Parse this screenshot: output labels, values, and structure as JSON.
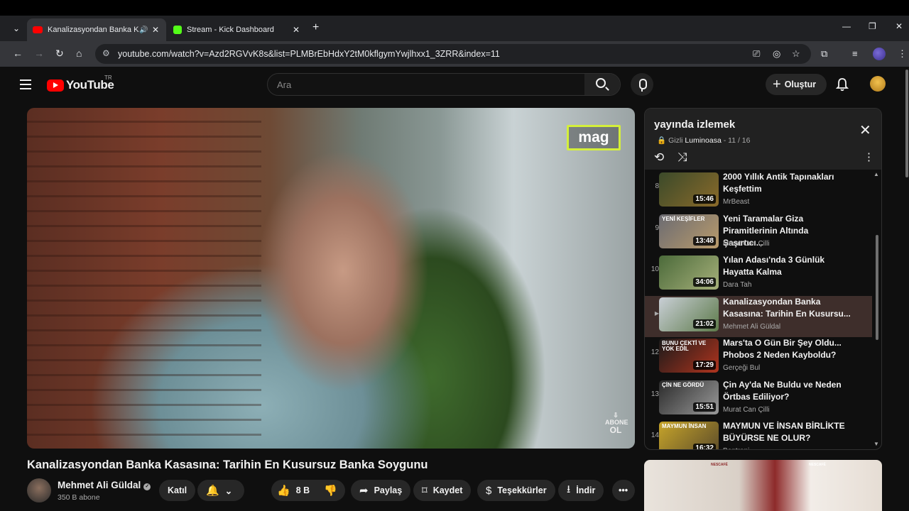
{
  "browser": {
    "tabs": [
      {
        "title": "Kanalizasyondan Banka Kasası",
        "active": true,
        "audio": true,
        "favicon": "youtube-favicon"
      },
      {
        "title": "Stream - Kick Dashboard",
        "active": false,
        "audio": false,
        "favicon": "kick-favicon"
      }
    ],
    "url": "youtube.com/watch?v=Azd2RGVvK8s&list=PLMBrEbHdxY2tM0kflgymYwjlhxx1_3ZRR&index=11",
    "icons": [
      "tab-search-icon",
      "back-icon",
      "forward-icon",
      "reload-icon",
      "home-icon",
      "site-info-icon",
      "cast-icon",
      "eye-off-icon",
      "star-icon",
      "extensions-icon",
      "media-controls-icon",
      "menu-icon",
      "minimize-icon",
      "maximize-icon",
      "close-icon"
    ]
  },
  "header": {
    "logo_text": "YouTube",
    "country_code": "TR",
    "search_placeholder": "Ara",
    "create_label": "Oluştur"
  },
  "video": {
    "title": "Kanalizasyondan Banka Kasasına: Tarihin En Kusursuz Banka Soygunu",
    "overlay_badge": "mag",
    "overlay_sub_line1": "ABONE",
    "overlay_sub_line2": "OL"
  },
  "channel": {
    "name": "Mehmet Ali Güldal",
    "subscribers": "350 B abone",
    "join_label": "Katıl"
  },
  "actions": {
    "likes": "8 B",
    "share": "Paylaş",
    "save": "Kaydet",
    "thanks": "Teşekkürler",
    "download": "İndir"
  },
  "playlist": {
    "title": "yayında izlemek",
    "privacy": "Gizli",
    "owner": "Luminoasa",
    "position": "- 11 / 16",
    "items": [
      {
        "index": "8",
        "title": "2000 Yıllık Antik Tapınakları Keşfettim",
        "author": "MrBeast",
        "duration": "15:46",
        "overlay": "",
        "current": false,
        "thumb_colors": [
          "#3b4a2a",
          "#8a6a2a"
        ]
      },
      {
        "index": "9",
        "title": "Yeni Taramalar Giza Piramitlerinin Altında Şaşırtıcı...",
        "author": "Murat Can Çilli",
        "duration": "13:48",
        "overlay": "YENİ KEŞİFLER",
        "current": false,
        "thumb_colors": [
          "#6b6b72",
          "#b99b6b"
        ]
      },
      {
        "index": "10",
        "title": "Yılan Adası'nda 3 Günlük Hayatta Kalma",
        "author": "Dara Tah",
        "duration": "34:06",
        "overlay": "",
        "current": false,
        "thumb_colors": [
          "#4b6a3a",
          "#a6b07a"
        ]
      },
      {
        "index": "",
        "title": "Kanalizasyondan Banka Kasasına: Tarihin En Kusursu...",
        "author": "Mehmet Ali Güldal",
        "duration": "21:02",
        "overlay": "",
        "current": true,
        "thumb_colors": [
          "#c9cfd6",
          "#5d7a4a"
        ]
      },
      {
        "index": "12",
        "title": "Mars'ta O Gün Bir Şey Oldu... Phobos 2 Neden Kayboldu?",
        "author": "Gerçeği Bul",
        "duration": "17:29",
        "overlay": "BUNU ÇEKTİ VE YOK EDİL",
        "current": false,
        "thumb_colors": [
          "#1a1a1a",
          "#b0341e"
        ]
      },
      {
        "index": "13",
        "title": "Çin Ay'da Ne Buldu ve Neden Örtbas Ediliyor?",
        "author": "Murat Can Çilli",
        "duration": "15:51",
        "overlay": "ÇİN NE GÖRDÜ",
        "current": false,
        "thumb_colors": [
          "#2a2a2a",
          "#9a9a9a"
        ]
      },
      {
        "index": "14",
        "title": "MAYMUN VE İNSAN BİRLİKTE BÜYÜRSE NE OLUR?",
        "author": "Bentropi",
        "duration": "16:32",
        "overlay": "MAYMUN   İNSAN",
        "current": false,
        "thumb_colors": [
          "#c7a52a",
          "#5a4a2a"
        ]
      }
    ]
  },
  "ad": {
    "brand_left": "NESCAFÉ",
    "brand_right": "NESCAFÉ"
  }
}
